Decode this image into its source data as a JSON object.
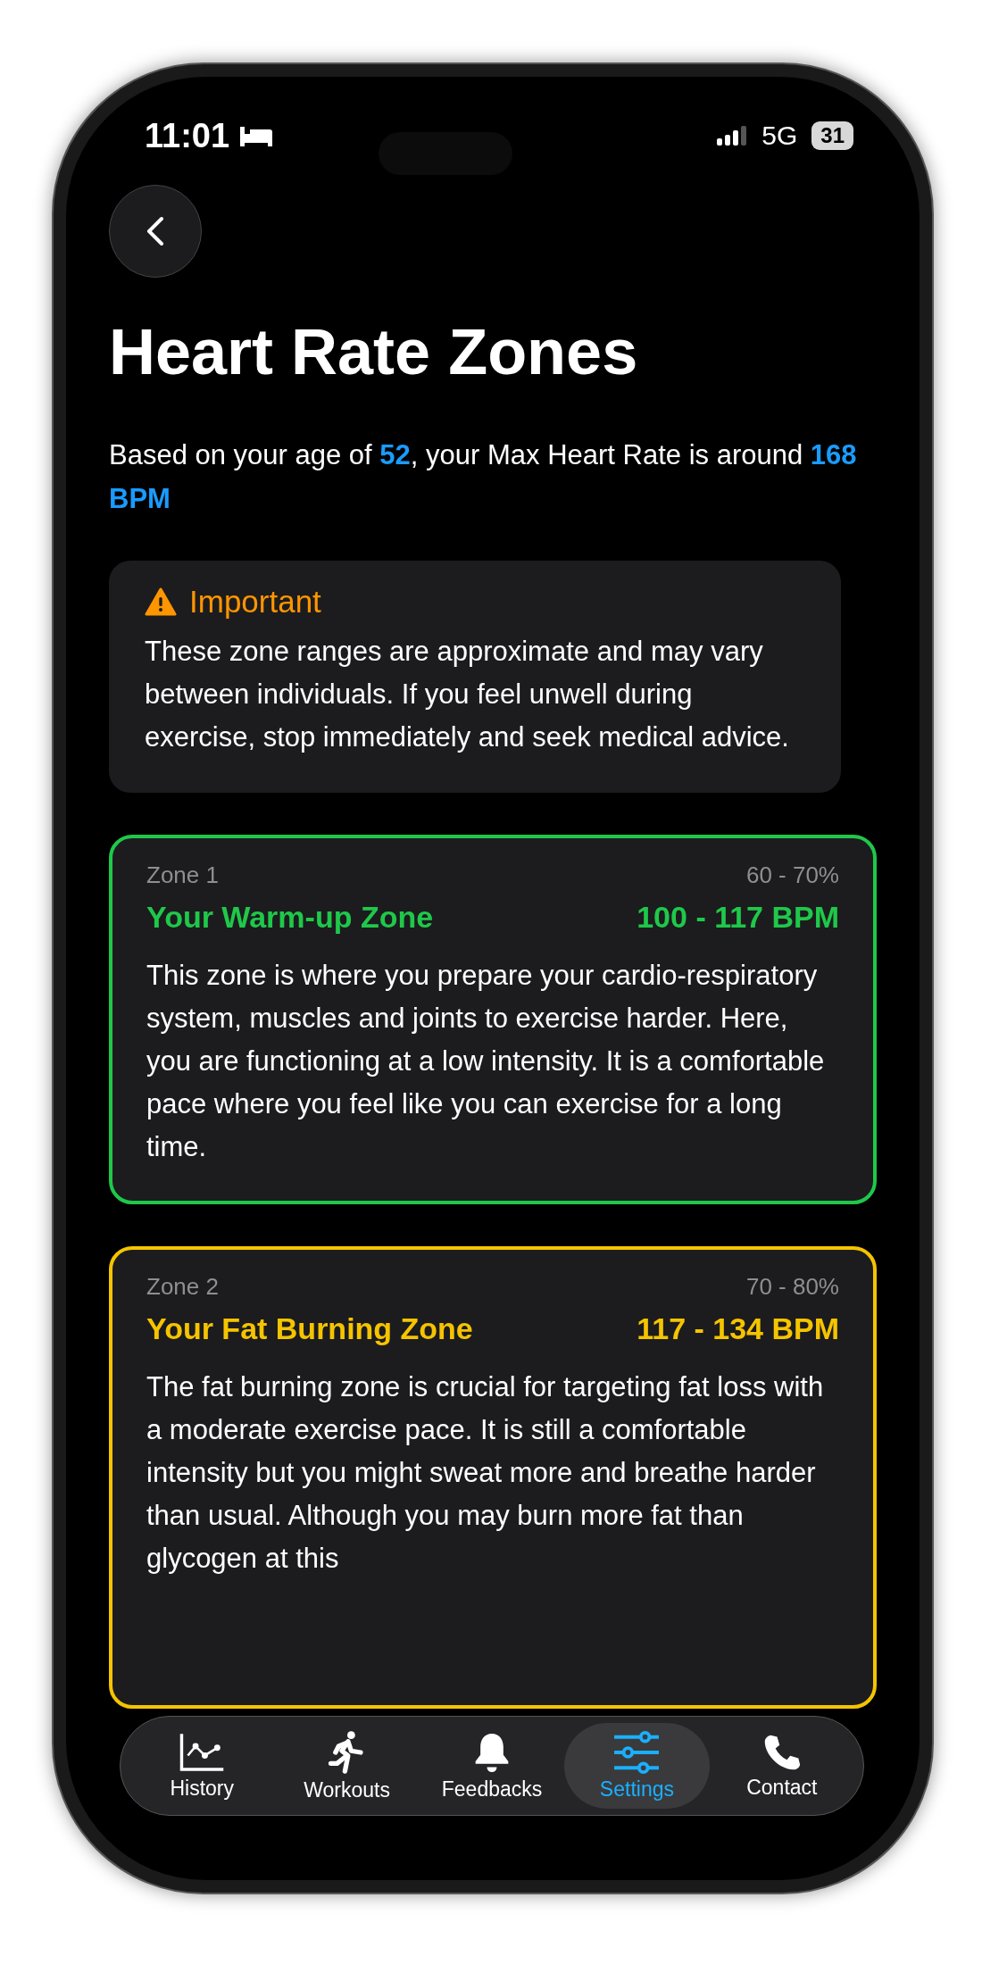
{
  "status_bar": {
    "time": "11:01",
    "network": "5G",
    "battery": "31"
  },
  "title": "Heart Rate Zones",
  "intro": "Based on your age of **52**, your Max Heart Rate is around **168 BPM**",
  "notice": {
    "title": "Important",
    "body": "These zone ranges are approximate and may vary between individuals. If you feel unwell during exercise, stop immediately and seek medical advice."
  },
  "zones": [
    {
      "label": "Zone 1",
      "percent": "60 - 70%",
      "name": "Your Warm-up Zone",
      "bpm": "100 - 117 BPM",
      "color": "#1fc84a",
      "description": "This zone is where you prepare your cardio-respiratory system, muscles and joints to exercise harder. Here, you are functioning at a low intensity. It is a comfortable pace where you feel like you can exercise for a long time."
    },
    {
      "label": "Zone 2",
      "percent": "70 - 80%",
      "name": "Your Fat Burning Zone",
      "bpm": "117 - 134 BPM",
      "color": "#f5c400",
      "description": "The fat burning zone is crucial for targeting fat loss with a moderate exercise pace. It is still a comfortable intensity but you might sweat more and breathe harder than usual. Although you may burn more fat than glycogen at this"
    }
  ],
  "tabs": [
    {
      "label": "History",
      "selected": false
    },
    {
      "label": "Workouts",
      "selected": false
    },
    {
      "label": "Feedbacks",
      "selected": false
    },
    {
      "label": "Settings",
      "selected": true
    },
    {
      "label": "Contact",
      "selected": false
    }
  ]
}
